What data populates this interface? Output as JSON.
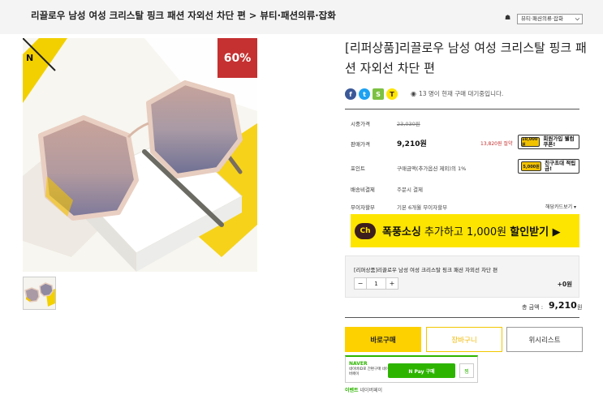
{
  "header": {
    "breadcrumb": "리끌로우 남성 여성 크리스탈 핑크 패션 자외선 차단 편 > 뷰티·패션의류·잡화",
    "category_select": "뷰티·패션의류·잡화"
  },
  "gallery": {
    "discount_badge": "60%"
  },
  "product": {
    "title": "[리퍼상품]리끌로우 남성 여성 크리스탈 핑크 패션 자외선 차단 편",
    "viewers": "13 명이 현재 구매 대기중입니다."
  },
  "share": {
    "facebook": "f",
    "twitter": "t",
    "kakaostory": "S",
    "kakaotalk": "T"
  },
  "info": {
    "list_price_label": "시중가격",
    "list_price_value": "23,030원",
    "sale_price_label": "판매가격",
    "sale_price_value": "9,210원",
    "sale_price_link": "13,820원 절약",
    "signup_coupon_icon": "10,000원",
    "signup_coupon_text": "회원가입 웰컴쿠폰!",
    "points_label": "포인트",
    "points_value": "구매금액(추가옵션 제외)의 1%",
    "invite_icon": "5,000원",
    "invite_text": "친구초대 적립금!",
    "shipping_label": "배송비결제",
    "shipping_value": "주문시 결제",
    "installment_label": "무이자할부",
    "installment_value": "기본 6개월 무이자할부",
    "card_link": "해당카드보기 ▾"
  },
  "kakao_banner": {
    "ch": "Ch",
    "bold_1": "폭풍소싱",
    "normal": " 추가하고 1,000원 ",
    "bold_2": "할인받기",
    "arrow": " ▶"
  },
  "option": {
    "name": "[리퍼상품]리끌로우 남성 여성 크리스탈 핑크 패션 자외선 차단 편",
    "minus": "−",
    "quantity": "1",
    "plus": "+",
    "price": "+0원"
  },
  "total": {
    "label": "총 금액 :",
    "value": "9,210",
    "unit": "원"
  },
  "actions": {
    "buy": "바로구매",
    "cart": "장바구니",
    "wishlist": "위시리스트"
  },
  "npay": {
    "logo": "NAVER",
    "desc": "네이버ID로 간편구매 네이버페이",
    "button": "N Pay 구매",
    "wish": "찜",
    "event_prefix": "이벤트",
    "event_text": " 네이버페이"
  },
  "colors": {
    "accent_yellow": "#fdd000",
    "badge_red": "#c53030",
    "naver_green": "#2db400"
  }
}
